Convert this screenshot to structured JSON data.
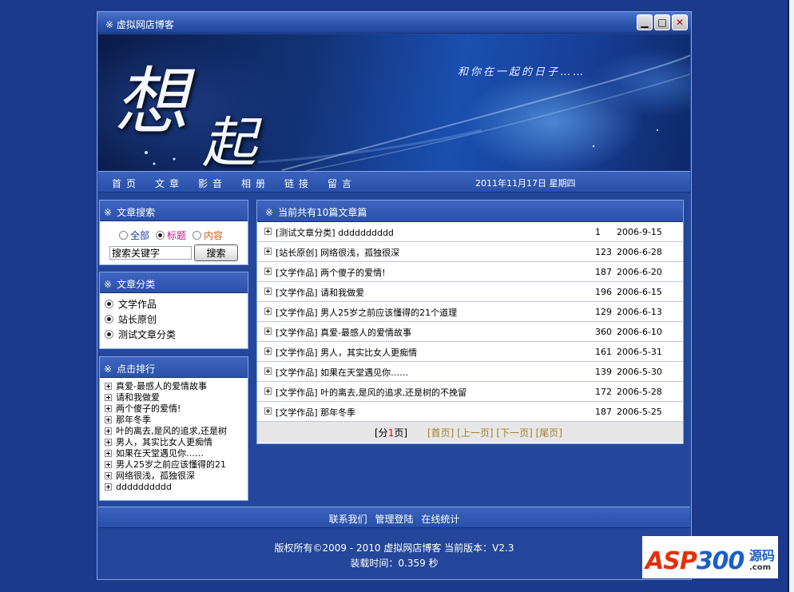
{
  "window": {
    "title": "※ 虚拟网店博客",
    "min_glyph": "▁",
    "max_glyph": "□",
    "close_glyph": "✕"
  },
  "banner": {
    "big_char_1": "想",
    "big_char_2": "起",
    "slogan": "和你在一起的日子……"
  },
  "nav": {
    "items": [
      "首页",
      "文章",
      "影音",
      "相册",
      "链接",
      "留言"
    ],
    "date": "2011年11月17日 星期四"
  },
  "search_box": {
    "header": "文章搜索",
    "options": [
      "全部",
      "标题",
      "内容"
    ],
    "selected": "标题",
    "input_value": "搜索关键字",
    "button_label": "搜索"
  },
  "category_box": {
    "header": "文章分类",
    "items": [
      "文学作品",
      "站长原创",
      "测试文章分类"
    ]
  },
  "rank_box": {
    "header": "点击排行",
    "items": [
      "真爱-最感人的爱情故事",
      "请和我做爱",
      "两个傻子的爱情!",
      "那年冬季",
      "叶的离去,是风的追求,还是树",
      "男人，其实比女人更痴情",
      "如果在天堂遇见你……",
      "男人25岁之前应该懂得的21",
      "网络很浅，孤独很深",
      "dddddddddd"
    ]
  },
  "main": {
    "header": "当前共有10篇文章篇",
    "articles": [
      {
        "title": "[测试文章分类] dddddddddd",
        "hits": "1",
        "date": "2006-9-15"
      },
      {
        "title": "[站长原创] 网络很浅，孤独很深",
        "hits": "123",
        "date": "2006-6-28"
      },
      {
        "title": "[文学作品] 两个傻子的爱情!",
        "hits": "187",
        "date": "2006-6-20"
      },
      {
        "title": "[文学作品] 请和我做爱",
        "hits": "196",
        "date": "2006-6-15"
      },
      {
        "title": "[文学作品] 男人25岁之前应该懂得的21个道理",
        "hits": "129",
        "date": "2006-6-13"
      },
      {
        "title": "[文学作品] 真爱-最感人的爱情故事",
        "hits": "360",
        "date": "2006-6-10"
      },
      {
        "title": "[文学作品] 男人，其实比女人更痴情",
        "hits": "161",
        "date": "2006-5-31"
      },
      {
        "title": "[文学作品] 如果在天堂遇见你……",
        "hits": "139",
        "date": "2006-5-30"
      },
      {
        "title": "[文学作品] 叶的离去,是风的追求,还是树的不挽留",
        "hits": "172",
        "date": "2006-5-28"
      },
      {
        "title": "[文学作品] 那年冬季",
        "hits": "187",
        "date": "2006-5-25"
      }
    ],
    "pager": {
      "info_prefix": "[分",
      "current": "1",
      "info_suffix": "页]",
      "links": [
        "[首页]",
        "[上一页]",
        "[下一页]",
        "[尾页]"
      ]
    }
  },
  "footer": {
    "links": [
      "联系我们",
      "管理登陆",
      "在线统计"
    ],
    "copyright": "版权所有©2009 - 2010 虚拟网店博客 当前版本：V2.3",
    "load_time": "装载时间：0.359 秒"
  },
  "watermark": {
    "asp": "ASP",
    "num": "300",
    "yuan": "源码",
    "com": ".com"
  }
}
